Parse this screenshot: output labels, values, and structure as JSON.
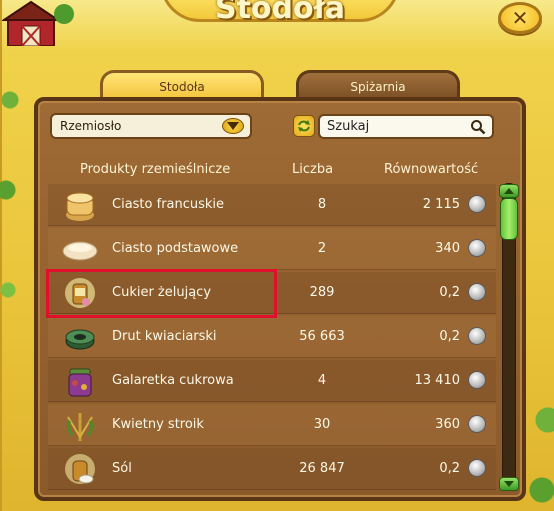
{
  "window": {
    "title": "Stodoła",
    "close_label": "✕"
  },
  "tabs": [
    {
      "label": "Stodoła",
      "active": true
    },
    {
      "label": "Spiżarnia",
      "active": false
    }
  ],
  "filter": {
    "category_selected": "Rzemiosło",
    "search_value": "Szukaj"
  },
  "table": {
    "columns": [
      "Produkty rzemieślnicze",
      "Liczba",
      "Równowartość"
    ],
    "rows": [
      {
        "icon": "puff-pastry-icon",
        "name": "Ciasto francuskie",
        "qty": "8",
        "value": "2 115"
      },
      {
        "icon": "basic-dough-icon",
        "name": "Ciasto podstawowe",
        "qty": "2",
        "value": "340"
      },
      {
        "icon": "gelling-sugar-icon",
        "name": "Cukier żelujący",
        "qty": "289",
        "value": "0,2"
      },
      {
        "icon": "florist-wire-icon",
        "name": "Drut kwiaciarski",
        "qty": "56 663",
        "value": "0,2"
      },
      {
        "icon": "sugar-jelly-jar-icon",
        "name": "Galaretka cukrowa",
        "qty": "4",
        "value": "13 410"
      },
      {
        "icon": "flower-decoration-icon",
        "name": "Kwietny stroik",
        "qty": "30",
        "value": "360"
      },
      {
        "icon": "salt-icon",
        "name": "Sól",
        "qty": "26 847",
        "value": "0,2"
      }
    ]
  },
  "highlighted_row": "Cukier żelujący",
  "scroll": {
    "position": 0.05
  },
  "colors": {
    "frame": "#f0d24a",
    "panel": "#8b5a2b",
    "highlight": "#e0102a",
    "scroll_thumb": "#5fc23a"
  }
}
